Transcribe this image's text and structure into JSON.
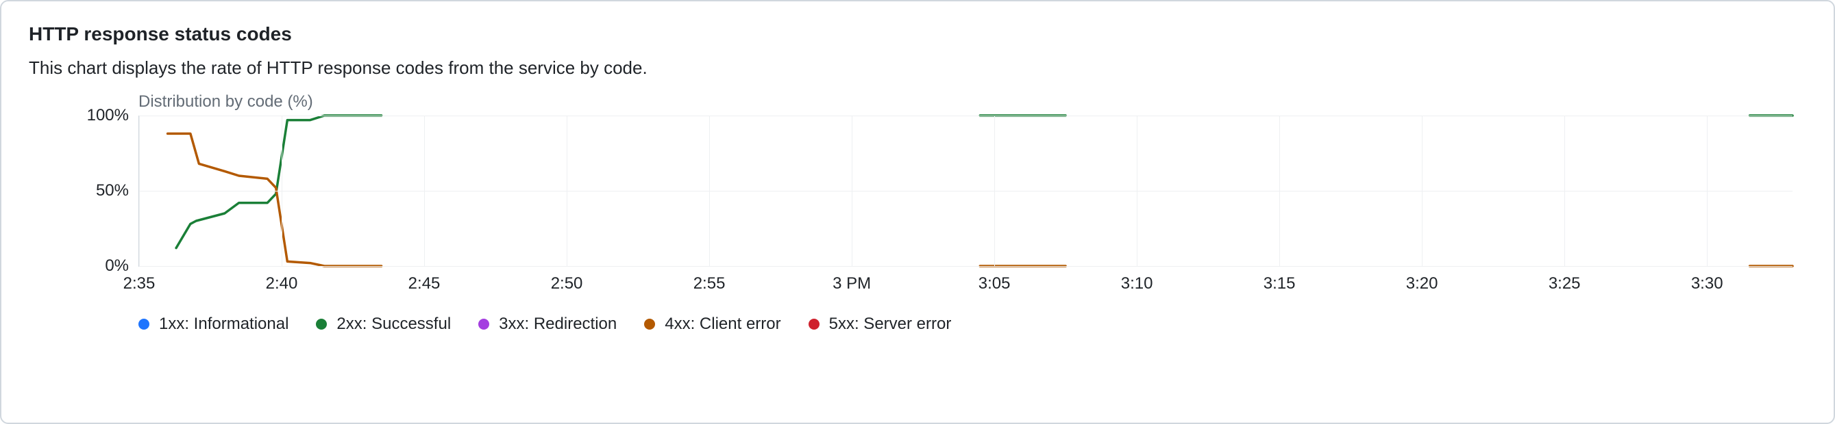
{
  "header": {
    "title": "HTTP response status codes",
    "subtitle": "This chart displays the rate of HTTP response codes from the service by code."
  },
  "chart_data": {
    "type": "line",
    "title": "Distribution by code (%)",
    "xlabel": "",
    "ylabel": "",
    "ylim": [
      0,
      100
    ],
    "y_ticks": [
      {
        "value": 0,
        "label": "0%"
      },
      {
        "value": 50,
        "label": "50%"
      },
      {
        "value": 100,
        "label": "100%"
      }
    ],
    "x_range_minutes": [
      155,
      213
    ],
    "x_ticks": [
      {
        "minute": 155,
        "label": "2:35"
      },
      {
        "minute": 160,
        "label": "2:40"
      },
      {
        "minute": 165,
        "label": "2:45"
      },
      {
        "minute": 170,
        "label": "2:50"
      },
      {
        "minute": 175,
        "label": "2:55"
      },
      {
        "minute": 180,
        "label": "3 PM"
      },
      {
        "minute": 185,
        "label": "3:05"
      },
      {
        "minute": 190,
        "label": "3:10"
      },
      {
        "minute": 195,
        "label": "3:15"
      },
      {
        "minute": 200,
        "label": "3:20"
      },
      {
        "minute": 205,
        "label": "3:25"
      },
      {
        "minute": 210,
        "label": "3:30"
      }
    ],
    "series": [
      {
        "name": "1xx: Informational",
        "color": "#1f75fe",
        "segments": []
      },
      {
        "name": "2xx: Successful",
        "color": "#1a7f37",
        "segments": [
          [
            {
              "minute": 156.3,
              "value": 12
            },
            {
              "minute": 156.8,
              "value": 28
            },
            {
              "minute": 157.0,
              "value": 30
            },
            {
              "minute": 158.0,
              "value": 35
            },
            {
              "minute": 158.5,
              "value": 42
            },
            {
              "minute": 159.5,
              "value": 42
            },
            {
              "minute": 159.8,
              "value": 48
            },
            {
              "minute": 160.2,
              "value": 97
            },
            {
              "minute": 161.0,
              "value": 97
            },
            {
              "minute": 161.5,
              "value": 100
            },
            {
              "minute": 163.5,
              "value": 100
            }
          ],
          [
            {
              "minute": 184.5,
              "value": 100
            },
            {
              "minute": 187.5,
              "value": 100
            }
          ],
          [
            {
              "minute": 211.5,
              "value": 100
            },
            {
              "minute": 213.0,
              "value": 100
            }
          ]
        ]
      },
      {
        "name": "3xx: Redirection",
        "color": "#a43ee0",
        "segments": []
      },
      {
        "name": "4xx: Client error",
        "color": "#b35900",
        "segments": [
          [
            {
              "minute": 156.0,
              "value": 88
            },
            {
              "minute": 156.8,
              "value": 88
            },
            {
              "minute": 157.1,
              "value": 68
            },
            {
              "minute": 158.0,
              "value": 63
            },
            {
              "minute": 158.5,
              "value": 60
            },
            {
              "minute": 159.5,
              "value": 58
            },
            {
              "minute": 159.8,
              "value": 52
            },
            {
              "minute": 160.2,
              "value": 3
            },
            {
              "minute": 161.0,
              "value": 2
            },
            {
              "minute": 161.5,
              "value": 0
            },
            {
              "minute": 163.5,
              "value": 0
            }
          ],
          [
            {
              "minute": 184.5,
              "value": 0
            },
            {
              "minute": 187.5,
              "value": 0
            }
          ],
          [
            {
              "minute": 211.5,
              "value": 0
            },
            {
              "minute": 213.0,
              "value": 0
            }
          ]
        ]
      },
      {
        "name": "5xx: Server error",
        "color": "#cf222e",
        "segments": []
      }
    ],
    "legend": [
      {
        "label": "1xx: Informational",
        "color": "#1f75fe"
      },
      {
        "label": "2xx: Successful",
        "color": "#1a7f37"
      },
      {
        "label": "3xx: Redirection",
        "color": "#a43ee0"
      },
      {
        "label": "4xx: Client error",
        "color": "#b35900"
      },
      {
        "label": "5xx: Server error",
        "color": "#cf222e"
      }
    ]
  }
}
